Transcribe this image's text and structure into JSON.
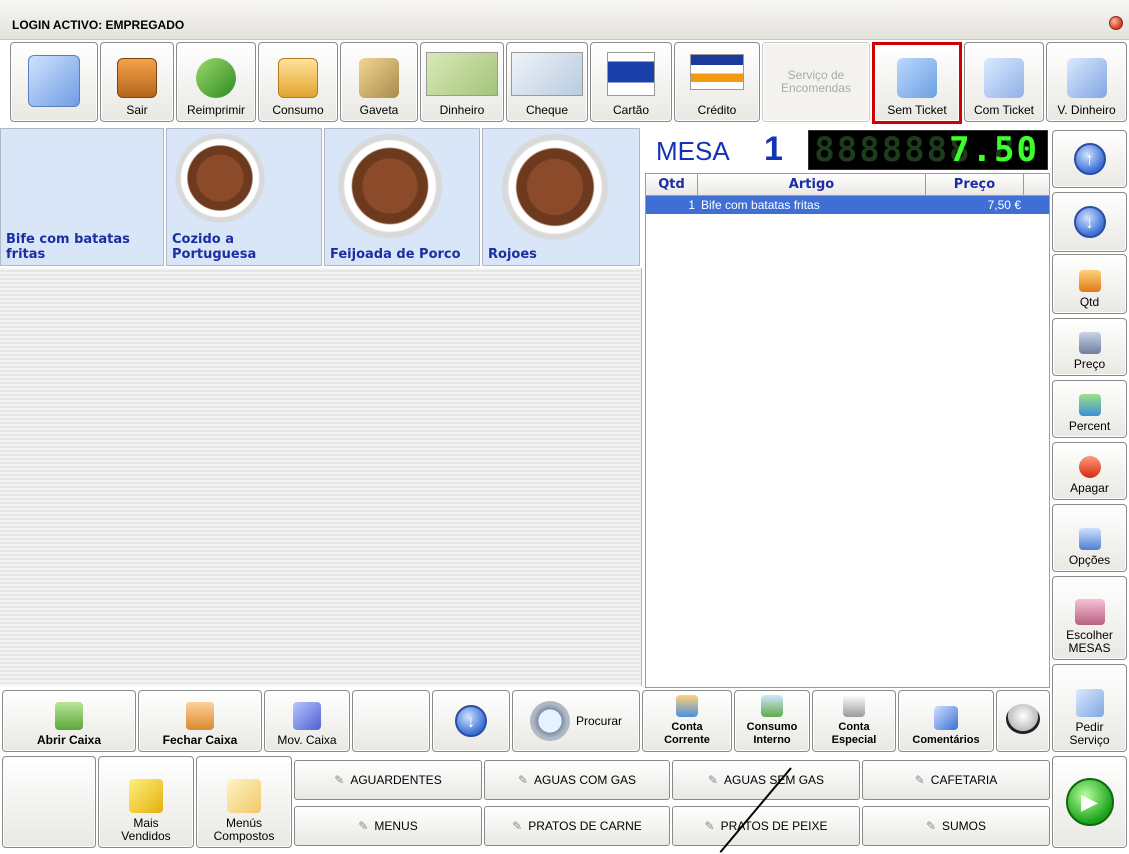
{
  "title": "LOGIN ACTIVO: EMPREGADO",
  "toolbar": {
    "sair": "Sair",
    "reimprimir": "Reimprimir",
    "consumo": "Consumo",
    "gaveta": "Gaveta",
    "dinheiro": "Dinheiro",
    "cheque": "Cheque",
    "cartao": "Cartão",
    "credito": "Crédito",
    "servico": "Serviço de Encomendas",
    "sem_ticket": "Sem Ticket",
    "com_ticket": "Com Ticket",
    "v_dinheiro": "V. Dinheiro"
  },
  "products": [
    {
      "name": "Bife com batatas fritas"
    },
    {
      "name": "Cozido a Portuguesa"
    },
    {
      "name": "Feijoada de Porco"
    },
    {
      "name": "Rojoes"
    }
  ],
  "mesa": {
    "label": "MESA",
    "number": "1"
  },
  "display": {
    "total": "7.50",
    "ghost": "8888888.88"
  },
  "order": {
    "headers": {
      "qtd": "Qtd",
      "artigo": "Artigo",
      "preco": "Preço"
    },
    "rows": [
      {
        "qtd": "1",
        "artigo": "Bife com batatas fritas",
        "preco": "7,50 €"
      }
    ]
  },
  "right_panel": {
    "qtd": "Qtd",
    "preco": "Preço",
    "percent": "Percent",
    "apagar": "Apagar",
    "opcoes": "Opções",
    "escolher_mesas": "Escolher MESAS",
    "pedir_servico": "Pedir Serviço"
  },
  "bottom": {
    "abrir_caixa": "Abrir Caixa",
    "fechar_caixa": "Fechar Caixa",
    "mov_caixa": "Mov. Caixa",
    "procurar": "Procurar",
    "conta_corrente": "Conta Corrente",
    "consumo_interno": "Consumo Interno",
    "conta_especial": "Conta Especial",
    "comentarios": "Comentários",
    "mais_vendidos": "Mais Vendidos",
    "menus_compostos": "Menús Compostos"
  },
  "categories": {
    "row1": [
      "AGUARDENTES",
      "AGUAS COM GAS",
      "AGUAS SEM GAS",
      "CAFETARIA"
    ],
    "row2": [
      "MENUS",
      "PRATOS DE CARNE",
      "PRATOS DE PEIXE",
      "SUMOS"
    ]
  },
  "colors": {
    "accent": "#1d2ea4",
    "selection": "#3f6fd4",
    "lcd": "#3cff2c",
    "highlight_border": "#d10000"
  }
}
